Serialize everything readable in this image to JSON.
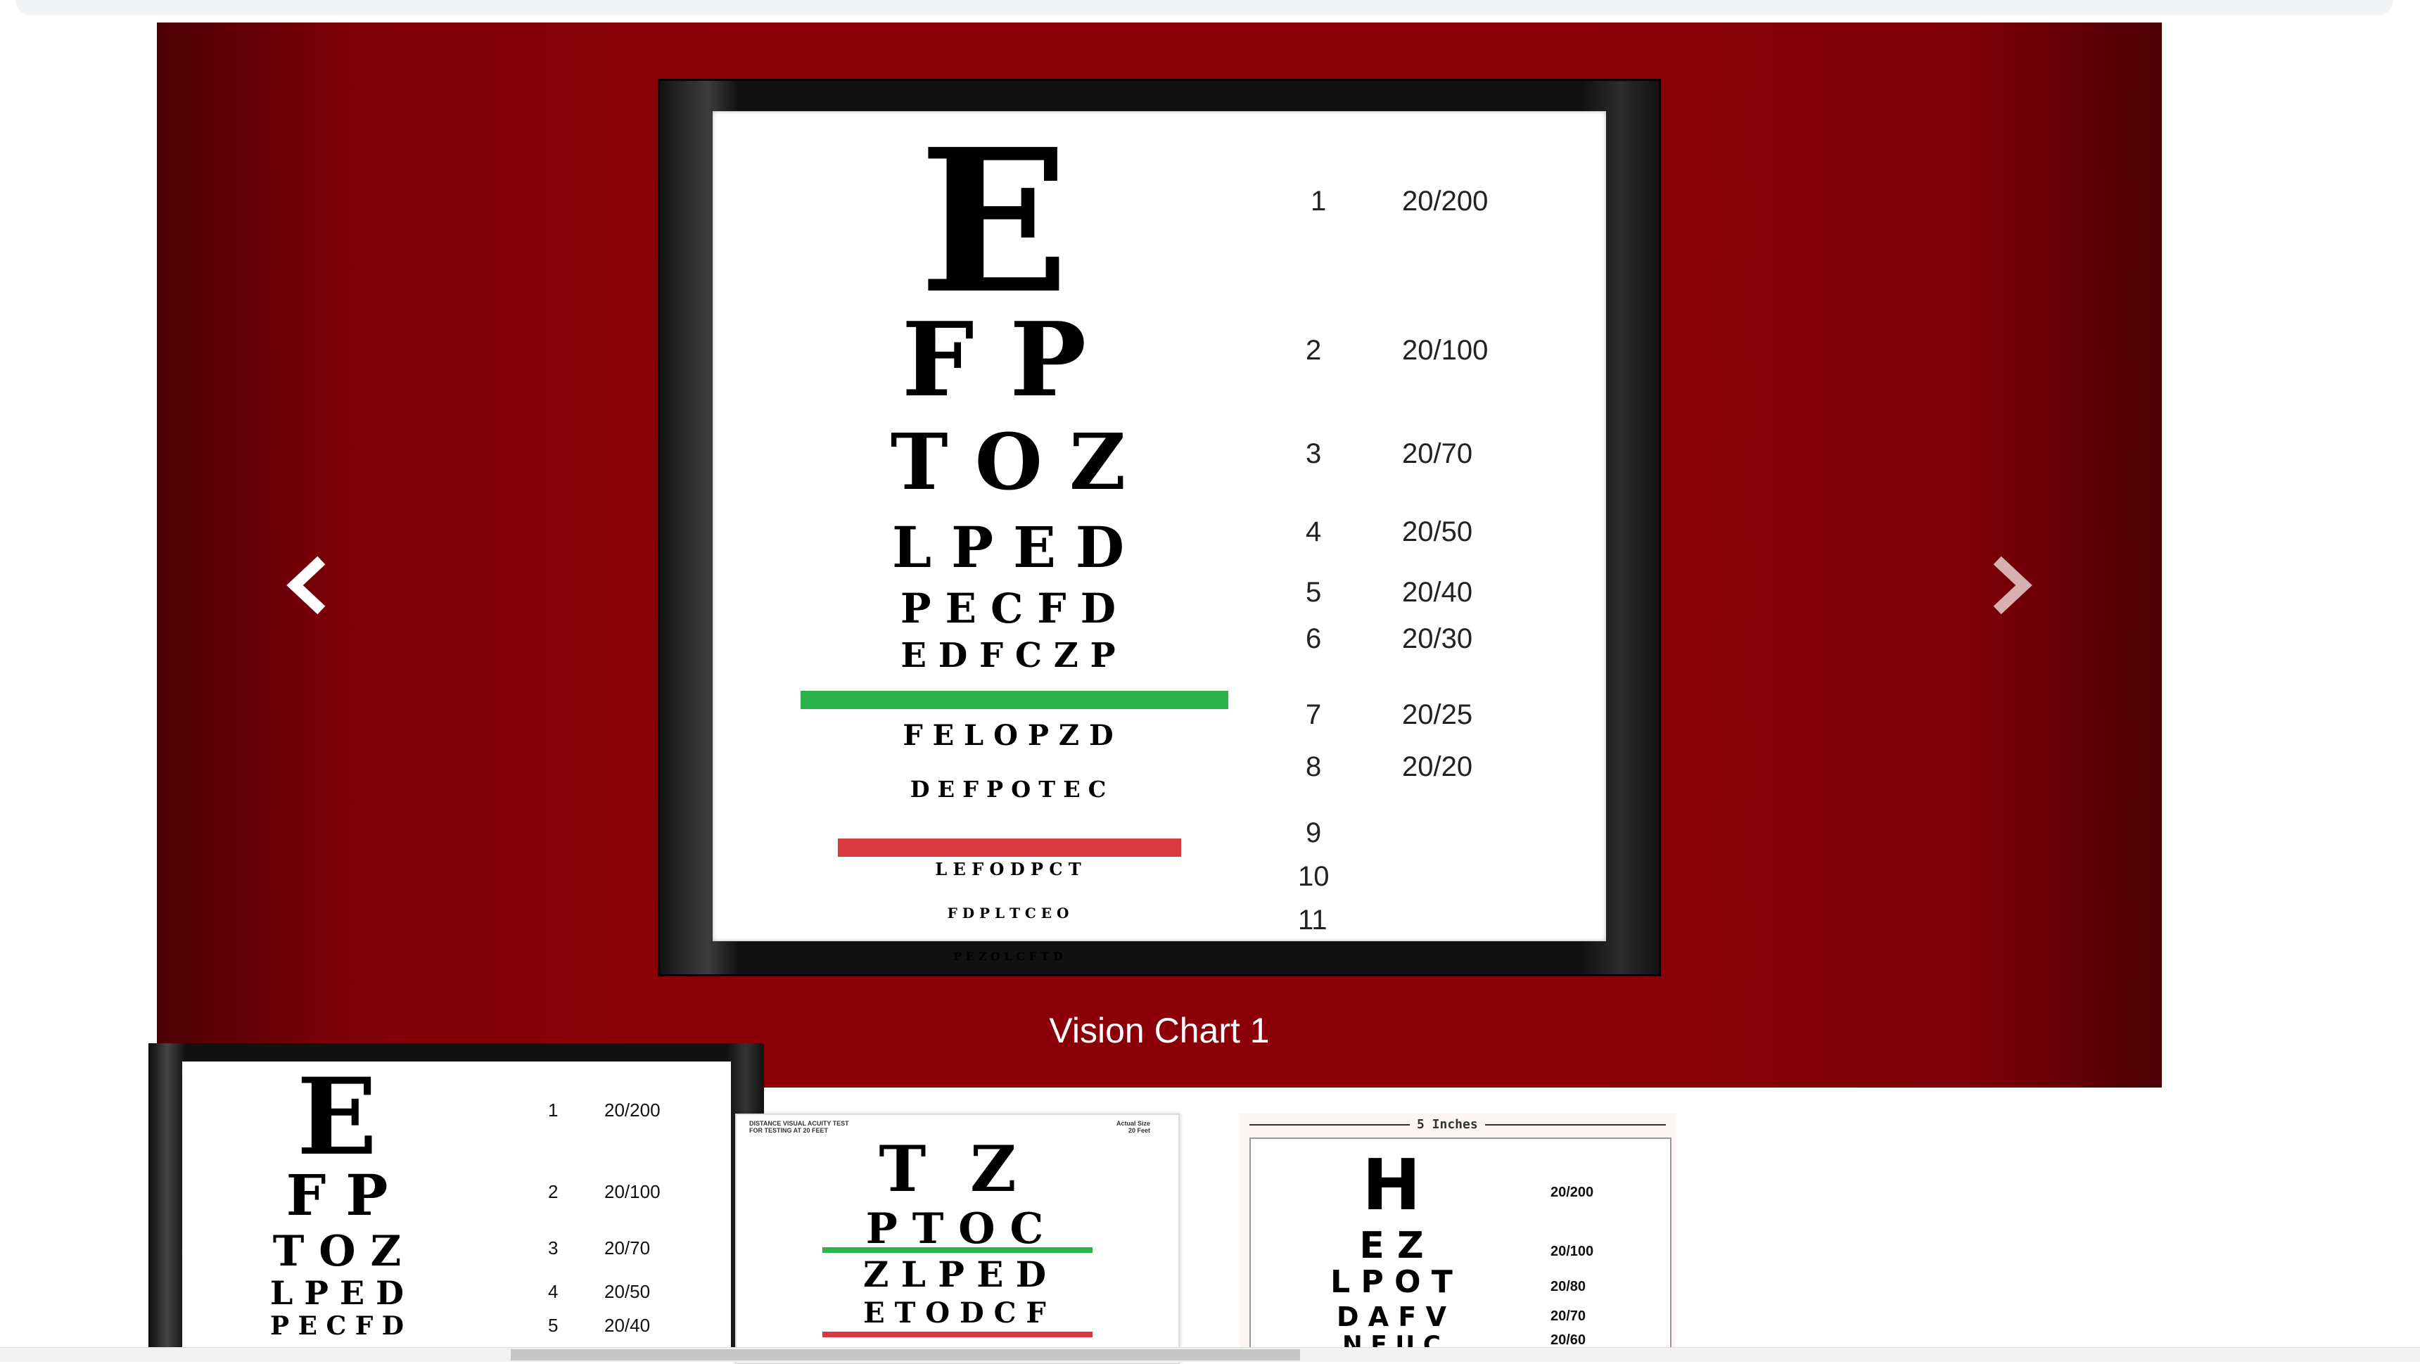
{
  "carousel": {
    "caption": "Vision Chart 1",
    "prev_icon": "chevron-left-icon",
    "next_icon": "chevron-right-icon",
    "main_chart": {
      "rows": [
        {
          "letters": "E",
          "num": "1",
          "ratio": "20/200"
        },
        {
          "letters": "F P",
          "num": "2",
          "ratio": "20/100"
        },
        {
          "letters": "T O Z",
          "num": "3",
          "ratio": "20/70"
        },
        {
          "letters": "L P E D",
          "num": "4",
          "ratio": "20/50"
        },
        {
          "letters": "P E C F D",
          "num": "5",
          "ratio": "20/40"
        },
        {
          "letters": "E D F C Z P",
          "num": "6",
          "ratio": "20/30"
        },
        {
          "letters": "F E L O P Z D",
          "num": "7",
          "ratio": "20/25"
        },
        {
          "letters": "D E F P O T E C",
          "num": "8",
          "ratio": "20/20"
        },
        {
          "letters": "L E F O D P C T",
          "num": "9",
          "ratio": ""
        },
        {
          "letters": "F D P L T C E O",
          "num": "10",
          "ratio": ""
        },
        {
          "letters": "P E Z O L C F T D",
          "num": "11",
          "ratio": ""
        }
      ],
      "green_bar_color": "#2bb34a",
      "red_bar_color": "#d63a3f"
    }
  },
  "thumbnails": {
    "thumb1": {
      "rows": [
        {
          "letters": "E",
          "num": "1",
          "ratio": "20/200"
        },
        {
          "letters": "F P",
          "num": "2",
          "ratio": "20/100"
        },
        {
          "letters": "T O Z",
          "num": "3",
          "ratio": "20/70"
        },
        {
          "letters": "L P E D",
          "num": "4",
          "ratio": "20/50"
        },
        {
          "letters": "P E C F D",
          "num": "5",
          "ratio": "20/40"
        }
      ]
    },
    "thumb2": {
      "header_left": "DISTANCE VISUAL ACUITY TEST\nFOR TESTING AT 20 FEET",
      "header_right": "Actual Size\n20 Feet",
      "rows": [
        {
          "letters": "T  Z"
        },
        {
          "letters": "P T O C"
        },
        {
          "letters": "Z L P E D"
        },
        {
          "letters": "E T O D C F"
        }
      ]
    },
    "thumb3": {
      "header": "5 Inches",
      "rows": [
        {
          "letters": "H",
          "ratio": "20/200"
        },
        {
          "letters": "E Z",
          "ratio": "20/100"
        },
        {
          "letters": "L P O T",
          "ratio": "20/80"
        },
        {
          "letters": "D A F V",
          "ratio": "20/70"
        },
        {
          "letters": "N E U C",
          "ratio": "20/60"
        }
      ]
    }
  }
}
